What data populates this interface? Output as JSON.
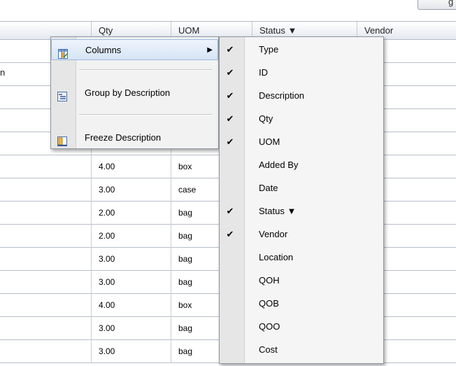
{
  "top": {
    "partial_text": "g"
  },
  "stray_text": "n",
  "grid": {
    "columns": [
      "",
      "Qty",
      "UOM",
      "Status ▼",
      "Vendor"
    ],
    "rows": [
      {
        "qty": "",
        "uom": ""
      },
      {
        "qty": "",
        "uom": ""
      },
      {
        "qty": "",
        "uom": ""
      },
      {
        "qty": "",
        "uom": ""
      },
      {
        "qty": "4.00",
        "uom": "box"
      },
      {
        "qty": "4.00",
        "uom": "box"
      },
      {
        "qty": "3.00",
        "uom": "case"
      },
      {
        "qty": "2.00",
        "uom": "bag"
      },
      {
        "qty": "2.00",
        "uom": "bag"
      },
      {
        "qty": "3.00",
        "uom": "bag"
      },
      {
        "qty": "3.00",
        "uom": "bag"
      },
      {
        "qty": "4.00",
        "uom": "box"
      },
      {
        "qty": "3.00",
        "uom": "bag"
      },
      {
        "qty": "3.00",
        "uom": "bag"
      }
    ]
  },
  "context_menu": {
    "items": [
      {
        "label": "Columns",
        "icon": "columns-icon",
        "submenu_arrow": "▶"
      },
      {
        "label": "Group by Description",
        "icon": "group-by-icon"
      },
      {
        "label": "Freeze Description",
        "icon": "freeze-icon"
      }
    ]
  },
  "columns_submenu": {
    "check_glyph": "✔",
    "items": [
      {
        "label": "Type",
        "checked": true
      },
      {
        "label": "ID",
        "checked": true
      },
      {
        "label": "Description",
        "checked": true
      },
      {
        "label": "Qty",
        "checked": true
      },
      {
        "label": "UOM",
        "checked": true
      },
      {
        "label": "Added By",
        "checked": false
      },
      {
        "label": "Date",
        "checked": false
      },
      {
        "label": "Status ▼",
        "checked": true
      },
      {
        "label": "Vendor",
        "checked": true
      },
      {
        "label": "Location",
        "checked": false
      },
      {
        "label": "QOH",
        "checked": false
      },
      {
        "label": "QOB",
        "checked": false
      },
      {
        "label": "QOO",
        "checked": false
      },
      {
        "label": "Cost",
        "checked": false
      }
    ]
  },
  "colors": {
    "menu_highlight": "#d6e5f6",
    "grid_line": "#b8bec8"
  }
}
